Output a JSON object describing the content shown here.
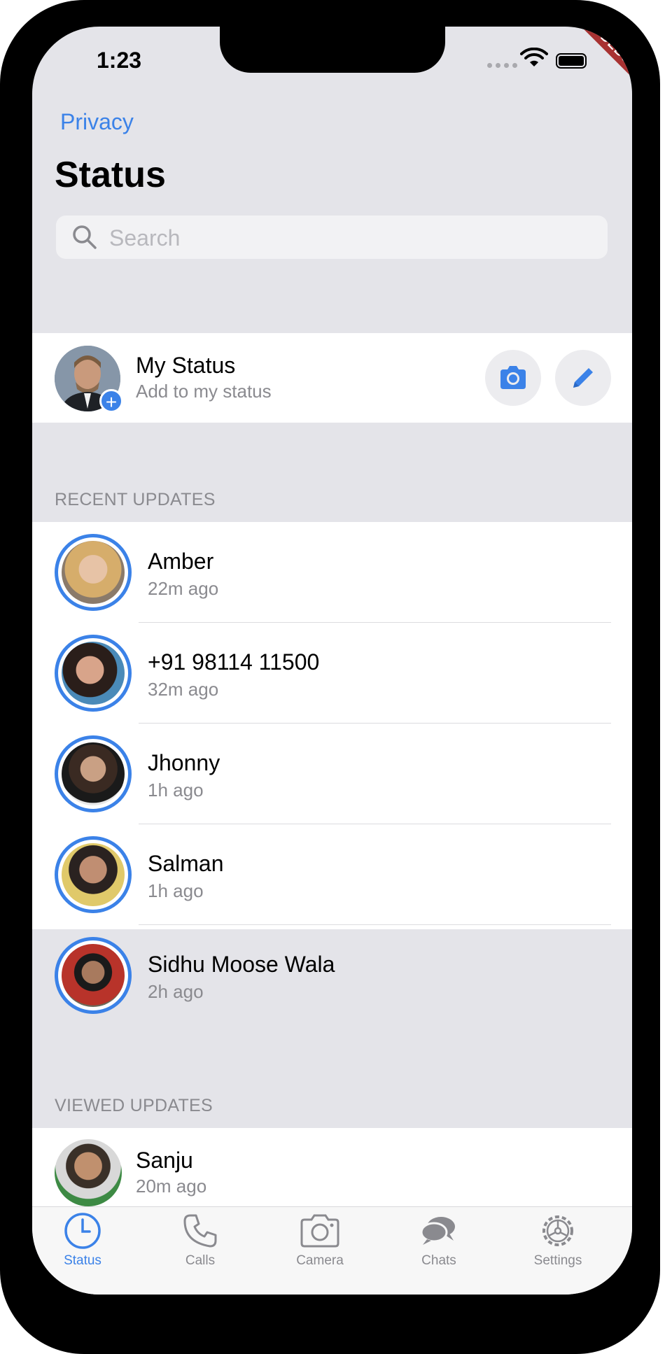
{
  "status_bar": {
    "time": "1:23"
  },
  "debug_banner": "DEBUG",
  "header": {
    "back_link": "Privacy",
    "title": "Status",
    "search_placeholder": "Search"
  },
  "my_status": {
    "name": "My Status",
    "subtitle": "Add to my status"
  },
  "recent": {
    "header": "RECENT UPDATES",
    "items": [
      {
        "name": "Amber",
        "time": "22m ago"
      },
      {
        "name": "+91 98114 11500",
        "time": "32m ago"
      },
      {
        "name": "Jhonny",
        "time": "1h ago"
      },
      {
        "name": "Salman",
        "time": "1h ago"
      },
      {
        "name": "Sidhu Moose Wala",
        "time": "2h ago"
      }
    ]
  },
  "viewed": {
    "header": "VIEWED UPDATES",
    "items": [
      {
        "name": "Sanju",
        "time": "20m ago"
      }
    ]
  },
  "tabs": [
    {
      "label": "Status",
      "icon": "clock-icon",
      "active": true
    },
    {
      "label": "Calls",
      "icon": "phone-icon",
      "active": false
    },
    {
      "label": "Camera",
      "icon": "camera-icon",
      "active": false
    },
    {
      "label": "Chats",
      "icon": "chat-bubbles-icon",
      "active": false
    },
    {
      "label": "Settings",
      "icon": "gear-icon",
      "active": false
    }
  ],
  "colors": {
    "accent": "#3b82e8",
    "background": "#e4e4e9",
    "secondary_text": "#8a8a8f"
  }
}
